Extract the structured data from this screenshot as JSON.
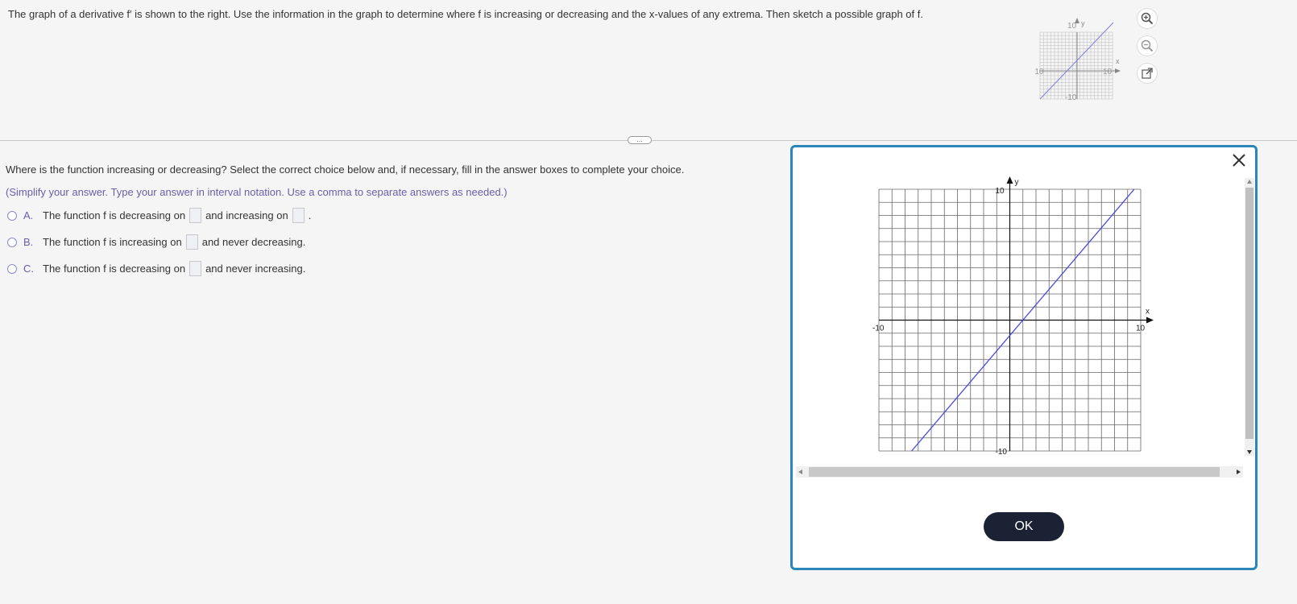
{
  "problem": {
    "text": "The graph of a derivative f′ is shown to the right. Use the information in the graph to determine where f is increasing or decreasing and the x-values of any extrema. Then sketch a possible graph of f."
  },
  "thumbnail": {
    "y_label": "y",
    "x_label": "x",
    "tick_top": "10",
    "tick_bottom": "-10",
    "tick_left": "-10",
    "tick_right": "10"
  },
  "tools": {
    "zoom_in": "zoom-in-icon",
    "zoom_out": "zoom-out-icon",
    "popout": "popout-icon"
  },
  "divider": {
    "handle": "..."
  },
  "question": {
    "prompt": "Where is the function increasing or decreasing? Select the correct choice below and, if necessary, fill in the answer boxes to complete your choice.",
    "hint": "(Simplify your answer. Type your answer in interval notation. Use a comma to separate answers as needed.)",
    "choices": [
      {
        "letter": "A.",
        "part1": "The function f is decreasing on",
        "part2": "and increasing on",
        "part3": "."
      },
      {
        "letter": "B.",
        "part1": "The function f is increasing on",
        "part2": "and never decreasing."
      },
      {
        "letter": "C.",
        "part1": "The function f is decreasing  on",
        "part2": "and never increasing."
      }
    ]
  },
  "modal": {
    "ok_label": "OK",
    "close": "close-icon"
  },
  "chart_data": {
    "type": "line",
    "xlim": [
      -10,
      10
    ],
    "ylim": [
      -10,
      10
    ],
    "grid": true,
    "xlabel": "x",
    "ylabel": "y",
    "tick_labels": {
      "x_min": "-10",
      "x_max": "10",
      "y_max": "10",
      "y_min": "-10"
    },
    "series": [
      {
        "color": "#4a4ae0",
        "x": [
          -7.5,
          9.5
        ],
        "y": [
          -10,
          10
        ]
      }
    ]
  }
}
